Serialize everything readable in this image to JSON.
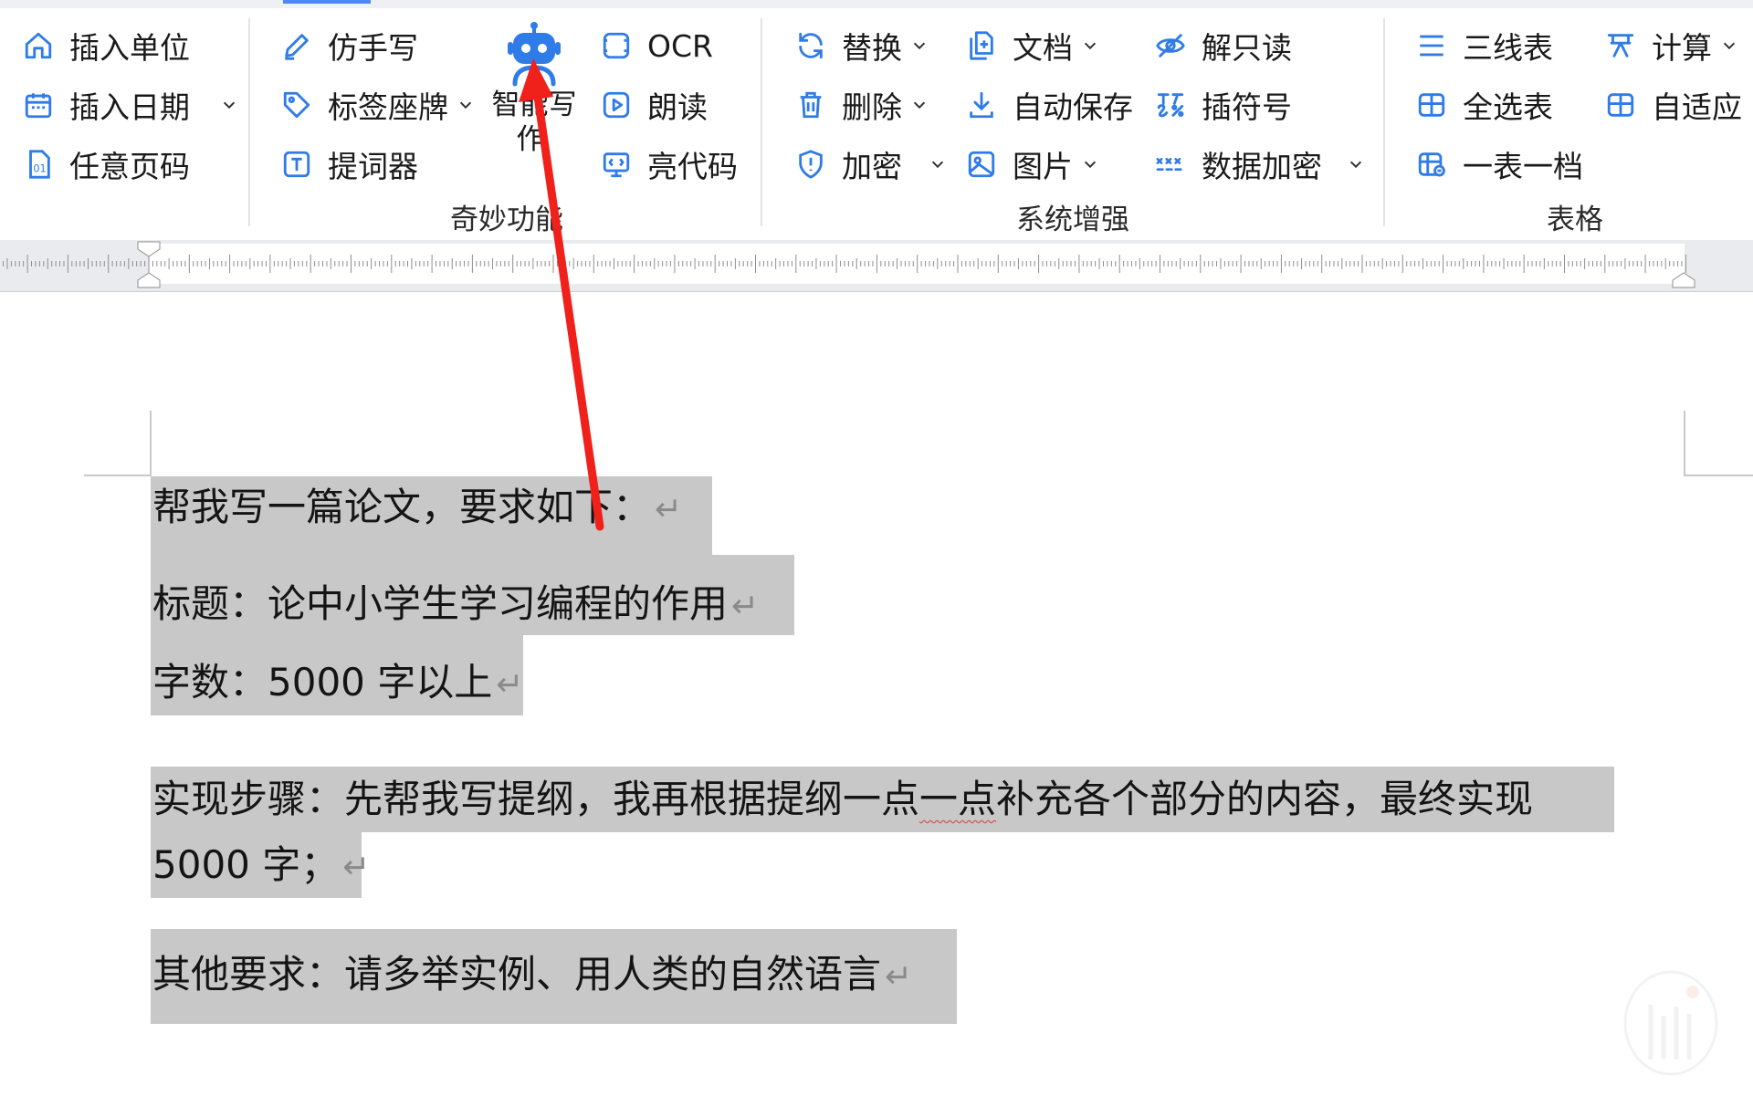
{
  "ribbon": {
    "group1": {
      "items": [
        {
          "label": "插入单位",
          "icon": "home-icon"
        },
        {
          "label": "插入日期",
          "icon": "calendar-icon"
        },
        {
          "label": "任意页码",
          "icon": "page-number-icon"
        }
      ]
    },
    "group2": {
      "label": "奇妙功能",
      "items": [
        {
          "label": "仿手写",
          "icon": "pen-icon"
        },
        {
          "label": "标签座牌",
          "icon": "tag-icon"
        },
        {
          "label": "提词器",
          "icon": "text-box-icon"
        },
        {
          "label": "OCR",
          "icon": "scan-icon"
        },
        {
          "label": "朗读",
          "icon": "play-icon"
        },
        {
          "label": "亮代码",
          "icon": "code-monitor-icon"
        }
      ],
      "big_button": {
        "line1": "智能写",
        "line2": "作",
        "icon": "robot-icon"
      }
    },
    "group3": {
      "label": "系统增强",
      "items": [
        {
          "label": "替换",
          "icon": "refresh-icon"
        },
        {
          "label": "删除",
          "icon": "trash-icon"
        },
        {
          "label": "加密",
          "icon": "shield-icon"
        },
        {
          "label": "文档",
          "icon": "document-add-icon"
        },
        {
          "label": "自动保存",
          "icon": "download-icon"
        },
        {
          "label": "图片",
          "icon": "image-icon"
        },
        {
          "label": "解只读",
          "icon": "eye-off-icon"
        },
        {
          "label": "插符号",
          "icon": "symbols-icon"
        },
        {
          "label": "数据加密",
          "icon": "data-encrypt-icon"
        }
      ]
    },
    "group4": {
      "label": "表格",
      "items": [
        {
          "label": "三线表",
          "icon": "three-lines-icon"
        },
        {
          "label": "全选表",
          "icon": "table-icon"
        },
        {
          "label": "一表一档",
          "icon": "table-link-icon"
        },
        {
          "label": "计算",
          "icon": "formula-icon"
        },
        {
          "label": "自适应",
          "icon": "table-fit-icon"
        }
      ]
    }
  },
  "document": {
    "paragraphs": [
      {
        "text": "帮我写一篇论文，要求如下："
      },
      {
        "text": "标题：论中小学生学习编程的作用"
      },
      {
        "text": "字数：5000 字以上"
      },
      {
        "line1_a": "实现步骤：先帮我写提纲，我再根据提纲一点",
        "line1_b": "一点",
        "line1_c": "补充各个部分的内容，最终实现",
        "line2": "5000 字；"
      },
      {
        "text": "其他要求：请多举实例、用人类的自然语言"
      }
    ],
    "return_mark": "↵"
  },
  "colors": {
    "accent": "#2f7be8",
    "selection": "#c8c8c8",
    "arrow": "#f0201a"
  }
}
